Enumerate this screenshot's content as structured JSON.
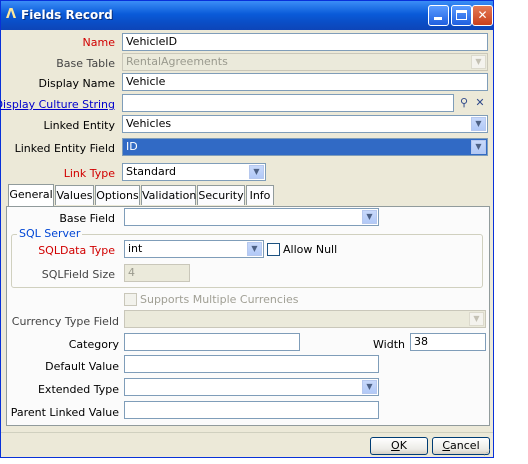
{
  "window": {
    "title": "Fields Record",
    "title_icon": "Λ",
    "buttons": [
      "minimize-icon",
      "maximize-icon",
      "close-icon"
    ]
  },
  "form": {
    "name": {
      "label": "Name",
      "value": "VehicleID"
    },
    "base_table": {
      "label": "Base Table",
      "value": "RentalAgreements"
    },
    "display_name": {
      "label": "Display Name",
      "value": "Vehicle"
    },
    "display_culture": {
      "label": "Display Culture String",
      "value": ""
    },
    "linked_entity": {
      "label": "Linked Entity",
      "value": "Vehicles"
    },
    "linked_entity_field": {
      "label": "Linked Entity Field",
      "value": "ID"
    },
    "link_type": {
      "label": "Link Type",
      "value": "Standard"
    }
  },
  "tabs": [
    {
      "label": "General",
      "active": true
    },
    {
      "label": "Values"
    },
    {
      "label": "Options"
    },
    {
      "label": "Validation"
    },
    {
      "label": "Security"
    },
    {
      "label": "Info"
    }
  ],
  "general": {
    "base_field": {
      "label": "Base Field",
      "value": ""
    },
    "sql_server_group": "SQL Server",
    "sql_data_type": {
      "label": "SQLData Type",
      "value": "int"
    },
    "allow_null": {
      "label": "Allow Null",
      "checked": false
    },
    "sql_field_size": {
      "label": "SQLField Size",
      "value": "4"
    },
    "supports_multiple_currencies": {
      "label": "Supports Multiple Currencies",
      "checked": false
    },
    "currency_type_field": {
      "label": "Currency Type Field",
      "value": ""
    },
    "category": {
      "label": "Category",
      "value": ""
    },
    "width": {
      "label": "Width",
      "value": "38"
    },
    "default_value": {
      "label": "Default Value",
      "value": ""
    },
    "extended_type": {
      "label": "Extended Type",
      "value": ""
    },
    "parent_linked_value": {
      "label": "Parent Linked Value",
      "value": ""
    }
  },
  "footer": {
    "ok": {
      "label": "K",
      "mnemonic": "O"
    },
    "cancel": {
      "label": "ancel",
      "mnemonic": "C"
    }
  },
  "colors": {
    "title_bar": "#0a5bd9",
    "required_label": "#d10000",
    "link_label": "#0000cc",
    "selection": "#316ac5"
  }
}
